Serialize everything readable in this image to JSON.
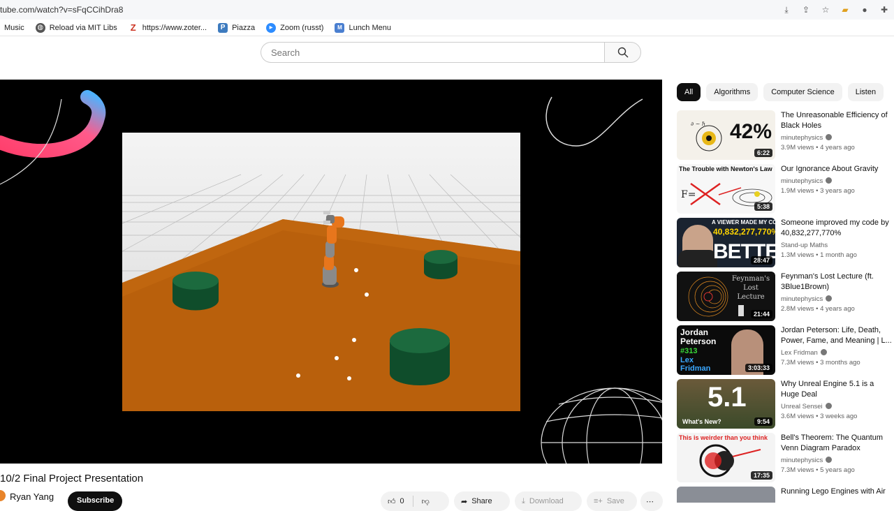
{
  "browser": {
    "url": "tube.com/watch?v=sFqCCihDra8"
  },
  "bookmarks": [
    {
      "label": "Music",
      "icon": "folder-icon"
    },
    {
      "label": "Reload via MIT Libs",
      "icon": "globe-icon"
    },
    {
      "label": "https://www.zoter...",
      "icon": "zotero-icon"
    },
    {
      "label": "Piazza",
      "icon": "piazza-icon"
    },
    {
      "label": "Zoom (russt)",
      "icon": "zoom-icon"
    },
    {
      "label": "Lunch Menu",
      "icon": "mit-icon"
    }
  ],
  "search": {
    "placeholder": "Search"
  },
  "video": {
    "title": "10/2 Final Project Presentation",
    "channel": "Ryan Yang",
    "subscribe_label": "Subscribe",
    "likes": "0",
    "share_label": "Share",
    "download_label": "Download",
    "save_label": "Save"
  },
  "chips": [
    "All",
    "Algorithms",
    "Computer Science",
    "Listen"
  ],
  "recommendations": [
    {
      "title": "The Unreasonable Efficiency of Black Holes",
      "channel": "minutephysics",
      "meta": "3.9M views • 4 years ago",
      "duration": "6:22",
      "thumb_text": "42%"
    },
    {
      "title": "Our Ignorance About Gravity",
      "channel": "minutephysics",
      "meta": "1.9M views • 3 years ago",
      "duration": "5:38",
      "thumb_text": "The Trouble with Newton's Law"
    },
    {
      "title": "Someone improved my code by 40,832,277,770%",
      "channel": "Stand-up Maths",
      "meta": "1.3M views • 1 month ago",
      "duration": "28:47",
      "thumb_text": "A VIEWER MADE MY CODE",
      "thumb_text2": "40,832,277,770%",
      "thumb_text3": "BETTER"
    },
    {
      "title": "Feynman's Lost Lecture (ft. 3Blue1Brown)",
      "channel": "minutephysics",
      "meta": "2.8M views • 4 years ago",
      "duration": "21:44",
      "thumb_text": "Feynman's Lost Lecture"
    },
    {
      "title": "Jordan Peterson: Life, Death, Power, Fame, and Meaning | L...",
      "channel": "Lex Fridman",
      "meta": "7.3M views • 3 months ago",
      "duration": "3:03:33",
      "thumb_text": "Jordan Peterson",
      "thumb_text2": "#313",
      "thumb_text3": "Lex Fridman"
    },
    {
      "title": "Why Unreal Engine 5.1 is a Huge Deal",
      "channel": "Unreal Sensei",
      "meta": "3.6M views • 3 weeks ago",
      "duration": "9:54",
      "thumb_text": "5.1",
      "thumb_text2": "What's New?"
    },
    {
      "title": "Bell's Theorem: The Quantum Venn Diagram Paradox",
      "channel": "minutephysics",
      "meta": "7.3M views • 5 years ago",
      "duration": "17:35",
      "thumb_text": "This is weirder than you think"
    },
    {
      "title": "Running Lego Engines with Air",
      "channel": "",
      "meta": "",
      "duration": "",
      "thumb_text": ""
    }
  ]
}
